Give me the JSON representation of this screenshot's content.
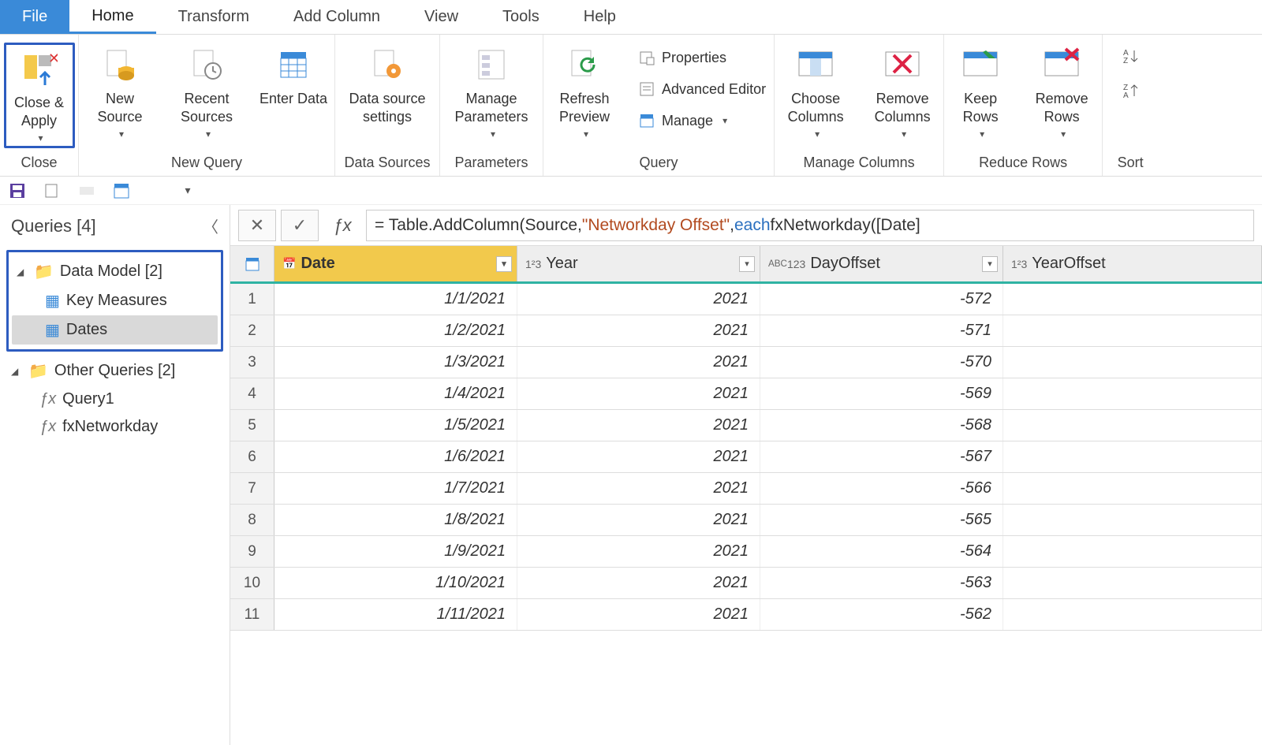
{
  "menu": {
    "file": "File",
    "home": "Home",
    "transform": "Transform",
    "addColumn": "Add Column",
    "view": "View",
    "tools": "Tools",
    "help": "Help"
  },
  "ribbon": {
    "closeGroup": "Close",
    "closeApply": "Close & Apply",
    "newQueryGroup": "New Query",
    "newSource": "New Source",
    "recentSources": "Recent Sources",
    "enterData": "Enter Data",
    "dataSourcesGroup": "Data Sources",
    "dataSourceSettings": "Data source settings",
    "parametersGroup": "Parameters",
    "manageParameters": "Manage Parameters",
    "queryGroup": "Query",
    "refreshPreview": "Refresh Preview",
    "properties": "Properties",
    "advancedEditor": "Advanced Editor",
    "manage": "Manage",
    "manageColumnsGroup": "Manage Columns",
    "chooseColumns": "Choose Columns",
    "removeColumns": "Remove Columns",
    "reduceRowsGroup": "Reduce Rows",
    "keepRows": "Keep Rows",
    "removeRows": "Remove Rows",
    "sortGroup": "Sort"
  },
  "sidebar": {
    "title": "Queries [4]",
    "group1": "Data Model [2]",
    "item1": "Key Measures",
    "item2": "Dates",
    "group2": "Other Queries [2]",
    "item3": "Query1",
    "item4": "fxNetworkday"
  },
  "formula": {
    "prefix": "= Table.AddColumn(Source, ",
    "string": "\"Networkday Offset\"",
    "mid": ", ",
    "kw": "each",
    "suffix": " fxNetworkday([Date]"
  },
  "columns": {
    "date": "Date",
    "year": "Year",
    "dayoff": "DayOffset",
    "yearoff": "YearOffset"
  },
  "rows": [
    {
      "n": "1",
      "date": "1/1/2021",
      "year": "2021",
      "off": "-572"
    },
    {
      "n": "2",
      "date": "1/2/2021",
      "year": "2021",
      "off": "-571"
    },
    {
      "n": "3",
      "date": "1/3/2021",
      "year": "2021",
      "off": "-570"
    },
    {
      "n": "4",
      "date": "1/4/2021",
      "year": "2021",
      "off": "-569"
    },
    {
      "n": "5",
      "date": "1/5/2021",
      "year": "2021",
      "off": "-568"
    },
    {
      "n": "6",
      "date": "1/6/2021",
      "year": "2021",
      "off": "-567"
    },
    {
      "n": "7",
      "date": "1/7/2021",
      "year": "2021",
      "off": "-566"
    },
    {
      "n": "8",
      "date": "1/8/2021",
      "year": "2021",
      "off": "-565"
    },
    {
      "n": "9",
      "date": "1/9/2021",
      "year": "2021",
      "off": "-564"
    },
    {
      "n": "10",
      "date": "1/10/2021",
      "year": "2021",
      "off": "-563"
    },
    {
      "n": "11",
      "date": "1/11/2021",
      "year": "2021",
      "off": "-562"
    }
  ]
}
